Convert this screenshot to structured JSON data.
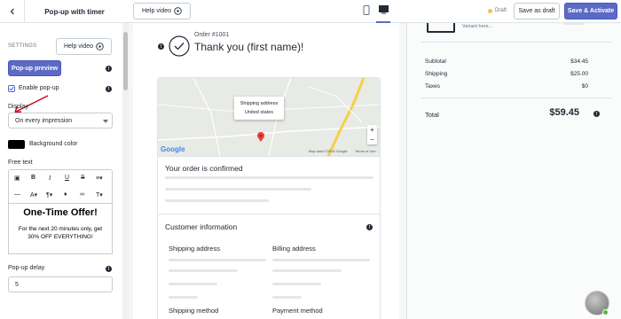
{
  "topbar": {
    "title": "Pop-up with timer",
    "help_video": "Help video",
    "draft_status": "Draft",
    "save_draft": "Save as draft",
    "save_activate": "Save & Activate"
  },
  "sidebar": {
    "section_label": "SETTINGS",
    "help_video": "Help video",
    "preview_button": "Pop-up preview",
    "enable_popup_label": "Enable pop-up",
    "display_label": "Display",
    "display_value": "On every impression",
    "bg_color_label": "Background color",
    "bg_color": "#000000",
    "free_text_label": "Free text",
    "editor_heading": "One-Time Offer!",
    "editor_body": "For the next 20 minutes only, get 30% OFF EVERYTHING!",
    "delay_label": "Pop-up delay",
    "delay_value": "5"
  },
  "preview": {
    "order_number": "Order #1001",
    "thank_you": "Thank you (first name)!",
    "map_tooltip_line1": "Shipping address",
    "map_tooltip_line2": "United states",
    "map_data_credit": "Map data ©2018 Google",
    "map_terms": "Terms of Use",
    "google_logo": "Google",
    "confirmed_title": "Your order is confirmed",
    "customer_info_title": "Customer information",
    "shipping_address": "Shipping address",
    "billing_address": "Billing address",
    "shipping_method": "Shipping method",
    "payment_method": "Payment method"
  },
  "summary": {
    "variant_text": "Variant here...",
    "subtotal_label": "Subtotal",
    "subtotal_value": "$34.45",
    "shipping_label": "Shipping",
    "shipping_value": "$25.00",
    "taxes_label": "Taxes",
    "taxes_value": "$0",
    "total_label": "Total",
    "total_value": "$59.45"
  },
  "colors": {
    "accent": "#5c6ac4",
    "draft_dot": "#f4c343",
    "annotation_arrow": "#d0021b",
    "avatar_status": "#50b83c"
  },
  "icons": [
    "play-icon",
    "tablet-icon",
    "desktop-icon",
    "info-icon",
    "chevron-down-icon",
    "check-circle-icon",
    "map-pin-icon"
  ]
}
